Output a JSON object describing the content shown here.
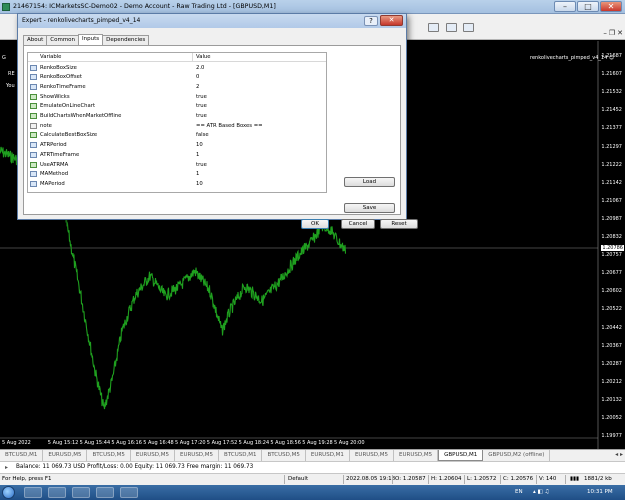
{
  "main_window": {
    "title": "21467154: ICMarketsSC-Demo02 - Demo Account - Raw Trading Ltd - [GBPUSD,M1]"
  },
  "dialog": {
    "title": "Expert - renkolivecharts_pimped_v4_14",
    "help_glyph": "?",
    "close_glyph": "✕",
    "tabs": [
      "About",
      "Common",
      "Inputs",
      "Dependencies"
    ],
    "active_tab": "Inputs",
    "grid": {
      "col_variable": "Variable",
      "col_value": "Value",
      "rows": [
        {
          "name": "RenkoBoxSize",
          "value": "2.0",
          "type": "num"
        },
        {
          "name": "RenkoBoxOffset",
          "value": "0",
          "type": "num"
        },
        {
          "name": "RenkoTimeFrame",
          "value": "2",
          "type": "num"
        },
        {
          "name": "ShowWicks",
          "value": "true",
          "type": "bool"
        },
        {
          "name": "EmulateOnLineChart",
          "value": "true",
          "type": "bool"
        },
        {
          "name": "BuildChartsWhenMarketOffline",
          "value": "true",
          "type": "bool"
        },
        {
          "name": "note",
          "value": "== ATR Based Boxes ==",
          "type": "str"
        },
        {
          "name": "CalculateBestBoxSize",
          "value": "false",
          "type": "bool"
        },
        {
          "name": "ATRPeriod",
          "value": "10",
          "type": "num"
        },
        {
          "name": "ATRTimeFrame",
          "value": "1",
          "type": "num"
        },
        {
          "name": "UseATRMA",
          "value": "true",
          "type": "bool"
        },
        {
          "name": "MAMethod",
          "value": "1",
          "type": "num"
        },
        {
          "name": "MAPeriod",
          "value": "10",
          "type": "num"
        }
      ]
    },
    "buttons": {
      "load": "Load",
      "save": "Save",
      "ok": "OK",
      "cancel": "Cancel",
      "reset": "Reset"
    }
  },
  "chart": {
    "indicator_label": "renkolivecharts_pimped_v4_14 ☺",
    "left_labels": [
      "G",
      "RE",
      "You"
    ],
    "current_price": "1.20786",
    "price_ticks": [
      "1.21687",
      "1.21607",
      "1.21532",
      "1.21452",
      "1.21377",
      "1.21297",
      "1.21222",
      "1.21142",
      "1.21067",
      "1.20987",
      "1.20832",
      "1.20757",
      "1.20677",
      "1.20602",
      "1.20522",
      "1.20442",
      "1.20367",
      "1.20287",
      "1.20212",
      "1.20132",
      "1.20052",
      "1.19977"
    ],
    "time_ticks": [
      "5 Aug 2022",
      "5 Aug 15:12",
      "5 Aug 15:44",
      "5 Aug 16:16",
      "5 Aug 16:48",
      "5 Aug 17:20",
      "5 Aug 17:52",
      "5 Aug 18:24",
      "5 Aug 18:56",
      "5 Aug 19:28",
      "5 Aug 20:00"
    ],
    "line_color": "#1fa01f"
  },
  "symbol_tabs": [
    "BTCUSD,M1",
    "EURUSD,M5",
    "BTCUSD,M5",
    "EURUSD,M5",
    "EURUSD,M5",
    "BTCUSD,M1",
    "BTCUSD,M5",
    "EURUSD,M1",
    "EURUSD,M5",
    "EURUSD,M5",
    "GBPUSD,M1",
    "GBPUSD,M2 (offline)"
  ],
  "active_symbol_tab": "GBPUSD,M1",
  "account": {
    "text": "Balance: 11 069.73 USD  Profit/Loss: 0.00  Equity: 11 069.73  Free margin: 11 069.73"
  },
  "status": {
    "help": "For Help, press F1",
    "profile": "Default",
    "datetime": "2022.08.05 19:18",
    "open": "O: 1.20587",
    "high": "H: 1.20604",
    "low": "L: 1.20572",
    "close": "C: 1.20576",
    "volume": "V: 140",
    "traffic": "1881/2 kb"
  },
  "taskbar": {
    "clock": "10:31 PM",
    "lang": "EN"
  }
}
